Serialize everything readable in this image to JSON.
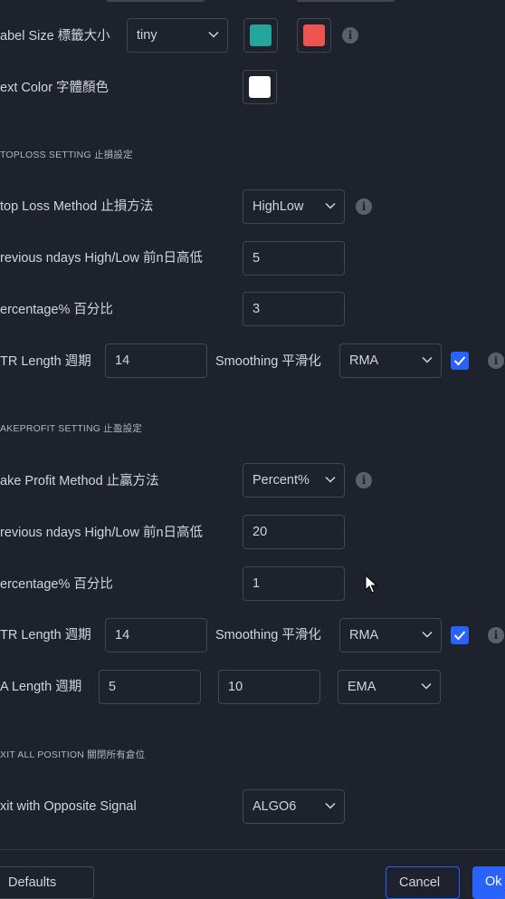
{
  "colors": {
    "background": "#1e222d",
    "teal": "#26a69a",
    "red": "#ef5350",
    "white": "#ffffff",
    "accent": "#2962ff"
  },
  "label_settings": {
    "label_size": "abel Size 標籤大小",
    "label_size_value": "tiny",
    "text_color": "ext Color 字體顏色"
  },
  "stoploss": {
    "section_title": "TOPLOSS SETTING 止損設定",
    "method_label": "top Loss Method 止損方法",
    "method_value": "HighLow",
    "prev_label": "revious ndays High/Low 前n日高低",
    "prev_value": "5",
    "pct_label": "ercentage% 百分比",
    "pct_value": "3",
    "atr_label": "TR Length 週期",
    "atr_value": "14",
    "smoothing_label": "Smoothing 平滑化",
    "smoothing_value": "RMA",
    "smoothing_checked": true
  },
  "takeprofit": {
    "section_title": "AKEPROFIT SETTING 止盈設定",
    "method_label": "ake Profit Method 止贏方法",
    "method_value": "Percent%",
    "prev_label": "revious ndays High/Low 前n日高低",
    "prev_value": "20",
    "pct_label": "ercentage% 百分比",
    "pct_value": "1",
    "atr_label": "TR Length 週期",
    "atr_value": "14",
    "smoothing_label": "Smoothing 平滑化",
    "smoothing_value": "RMA",
    "smoothing_checked": true,
    "ma_label": "A Length 週期",
    "ma_value_1": "5",
    "ma_value_2": "10",
    "ma_type": "EMA"
  },
  "exit": {
    "section_title": "XIT ALL POSITION 關閉所有倉位",
    "opposite_label": "xit with Opposite Signal",
    "opposite_value": "ALGO6"
  },
  "footer": {
    "defaults_label": "Defaults",
    "cancel_label": "Cancel",
    "ok_label": "Ok"
  }
}
